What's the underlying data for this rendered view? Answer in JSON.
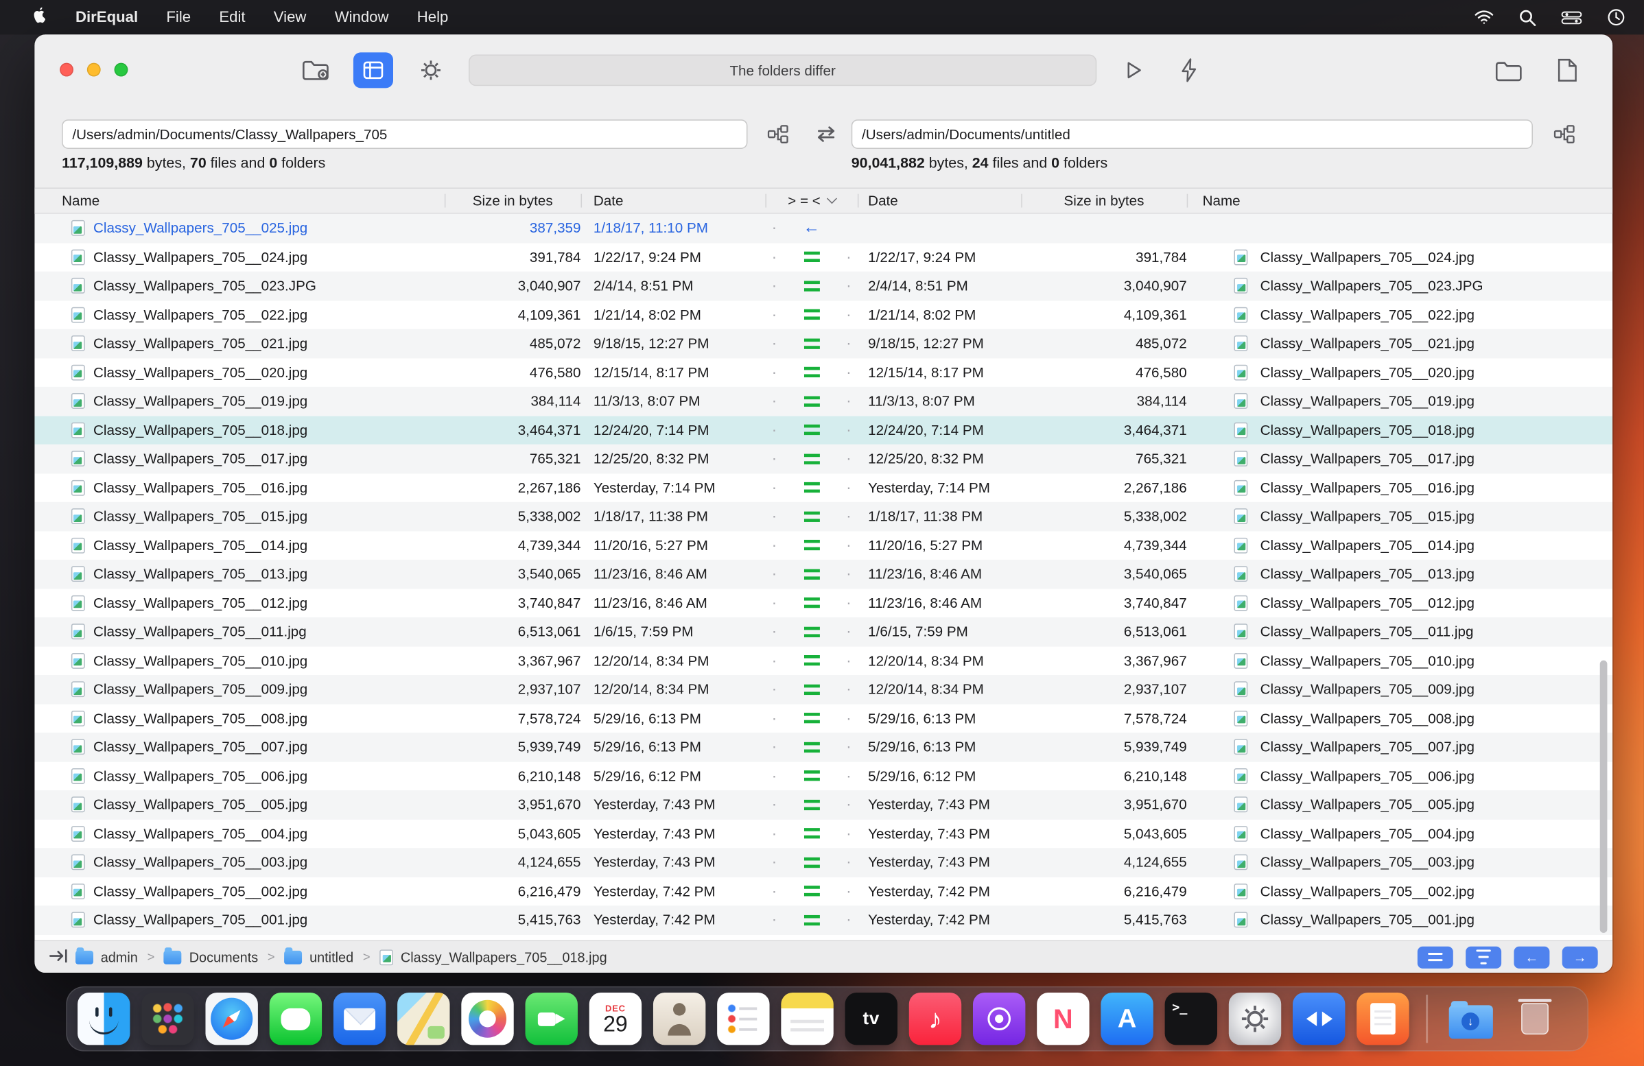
{
  "menu_bar": {
    "app_name": "DirEqual",
    "menus": [
      "File",
      "Edit",
      "View",
      "Window",
      "Help"
    ],
    "status_icons": [
      "wifi-icon",
      "search-icon",
      "control-center-icon",
      "clock-icon"
    ]
  },
  "window": {
    "toolbar": {
      "status_text": "The folders differ",
      "buttons": [
        "compare-folders",
        "compare",
        "settings",
        "run",
        "auto-compare",
        "open-left-folder",
        "open-right-file"
      ]
    },
    "left_panel": {
      "path": "/Users/admin/Documents/Classy_Wallpapers_705",
      "stats": {
        "bytes": "117,109,889",
        "bytes_label": " bytes, ",
        "files": "70",
        "files_label": " files and ",
        "folders": "0",
        "folders_label": " folders"
      }
    },
    "right_panel": {
      "path": "/Users/admin/Documents/untitled",
      "stats": {
        "bytes": "90,041,882",
        "bytes_label": " bytes, ",
        "files": "24",
        "files_label": " files and ",
        "folders": "0",
        "folders_label": " folders"
      }
    },
    "table": {
      "headers": {
        "left_name": "Name",
        "left_size": "Size in bytes",
        "left_date": "Date",
        "comparison": "> = <",
        "right_date": "Date",
        "right_size": "Size in bytes",
        "right_name": "Name"
      },
      "dot_glyph": "·",
      "left_arrow_glyph": "←",
      "rows": [
        {
          "name": "Classy_Wallpapers_705__025.jpg",
          "size": "387,359",
          "date": "1/18/17, 11:10 PM",
          "status": "left-only",
          "selected": false
        },
        {
          "name": "Classy_Wallpapers_705__024.jpg",
          "size": "391,784",
          "date": "1/22/17, 9:24 PM",
          "status": "equal",
          "selected": false
        },
        {
          "name": "Classy_Wallpapers_705__023.JPG",
          "size": "3,040,907",
          "date": "2/4/14, 8:51 PM",
          "status": "equal",
          "selected": false
        },
        {
          "name": "Classy_Wallpapers_705__022.jpg",
          "size": "4,109,361",
          "date": "1/21/14, 8:02 PM",
          "status": "equal",
          "selected": false
        },
        {
          "name": "Classy_Wallpapers_705__021.jpg",
          "size": "485,072",
          "date": "9/18/15, 12:27 PM",
          "status": "equal",
          "selected": false
        },
        {
          "name": "Classy_Wallpapers_705__020.jpg",
          "size": "476,580",
          "date": "12/15/14, 8:17 PM",
          "status": "equal",
          "selected": false
        },
        {
          "name": "Classy_Wallpapers_705__019.jpg",
          "size": "384,114",
          "date": "11/3/13, 8:07 PM",
          "status": "equal",
          "selected": false
        },
        {
          "name": "Classy_Wallpapers_705__018.jpg",
          "size": "3,464,371",
          "date": "12/24/20, 7:14 PM",
          "status": "equal",
          "selected": true
        },
        {
          "name": "Classy_Wallpapers_705__017.jpg",
          "size": "765,321",
          "date": "12/25/20, 8:32 PM",
          "status": "equal",
          "selected": false
        },
        {
          "name": "Classy_Wallpapers_705__016.jpg",
          "size": "2,267,186",
          "date": "Yesterday, 7:14 PM",
          "status": "equal",
          "selected": false
        },
        {
          "name": "Classy_Wallpapers_705__015.jpg",
          "size": "5,338,002",
          "date": "1/18/17, 11:38 PM",
          "status": "equal",
          "selected": false
        },
        {
          "name": "Classy_Wallpapers_705__014.jpg",
          "size": "4,739,344",
          "date": "11/20/16, 5:27 PM",
          "status": "equal",
          "selected": false
        },
        {
          "name": "Classy_Wallpapers_705__013.jpg",
          "size": "3,540,065",
          "date": "11/23/16, 8:46 AM",
          "status": "equal",
          "selected": false
        },
        {
          "name": "Classy_Wallpapers_705__012.jpg",
          "size": "3,740,847",
          "date": "11/23/16, 8:46 AM",
          "status": "equal",
          "selected": false
        },
        {
          "name": "Classy_Wallpapers_705__011.jpg",
          "size": "6,513,061",
          "date": "1/6/15, 7:59 PM",
          "status": "equal",
          "selected": false
        },
        {
          "name": "Classy_Wallpapers_705__010.jpg",
          "size": "3,367,967",
          "date": "12/20/14, 8:34 PM",
          "status": "equal",
          "selected": false
        },
        {
          "name": "Classy_Wallpapers_705__009.jpg",
          "size": "2,937,107",
          "date": "12/20/14, 8:34 PM",
          "status": "equal",
          "selected": false
        },
        {
          "name": "Classy_Wallpapers_705__008.jpg",
          "size": "7,578,724",
          "date": "5/29/16, 6:13 PM",
          "status": "equal",
          "selected": false
        },
        {
          "name": "Classy_Wallpapers_705__007.jpg",
          "size": "5,939,749",
          "date": "5/29/16, 6:13 PM",
          "status": "equal",
          "selected": false
        },
        {
          "name": "Classy_Wallpapers_705__006.jpg",
          "size": "6,210,148",
          "date": "5/29/16, 6:12 PM",
          "status": "equal",
          "selected": false
        },
        {
          "name": "Classy_Wallpapers_705__005.jpg",
          "size": "3,951,670",
          "date": "Yesterday, 7:43 PM",
          "status": "equal",
          "selected": false
        },
        {
          "name": "Classy_Wallpapers_705__004.jpg",
          "size": "5,043,605",
          "date": "Yesterday, 7:43 PM",
          "status": "equal",
          "selected": false
        },
        {
          "name": "Classy_Wallpapers_705__003.jpg",
          "size": "4,124,655",
          "date": "Yesterday, 7:43 PM",
          "status": "equal",
          "selected": false
        },
        {
          "name": "Classy_Wallpapers_705__002.jpg",
          "size": "6,216,479",
          "date": "Yesterday, 7:42 PM",
          "status": "equal",
          "selected": false
        },
        {
          "name": "Classy_Wallpapers_705__001.jpg",
          "size": "5,415,763",
          "date": "Yesterday, 7:42 PM",
          "status": "equal",
          "selected": false
        }
      ]
    },
    "status_bar": {
      "breadcrumbs": [
        "admin",
        "Documents",
        "untitled"
      ],
      "separator": ">",
      "selected_file": "Classy_Wallpapers_705__018.jpg"
    }
  },
  "dock": {
    "apps": [
      "finder",
      "launchpad",
      "safari",
      "messages",
      "mail",
      "maps",
      "photos",
      "facetime",
      "calendar",
      "contacts",
      "reminders",
      "notes",
      "tv",
      "music",
      "podcasts",
      "news",
      "app-store",
      "terminal",
      "system-preferences",
      "direqual",
      "books",
      "downloads",
      "trash"
    ],
    "glyphs": {
      "calendar_month": "DEC",
      "calendar_day": "29",
      "tv": "tv",
      "music": "♪",
      "news": "N",
      "app_store": "A",
      "terminal": ">_",
      "downloads_arrow": "↓"
    }
  },
  "colors": {
    "accent_blue": "#3b7bf7",
    "equal_green": "#17b13a",
    "diff_blue": "#2864e0",
    "selection": "#d5edee"
  }
}
